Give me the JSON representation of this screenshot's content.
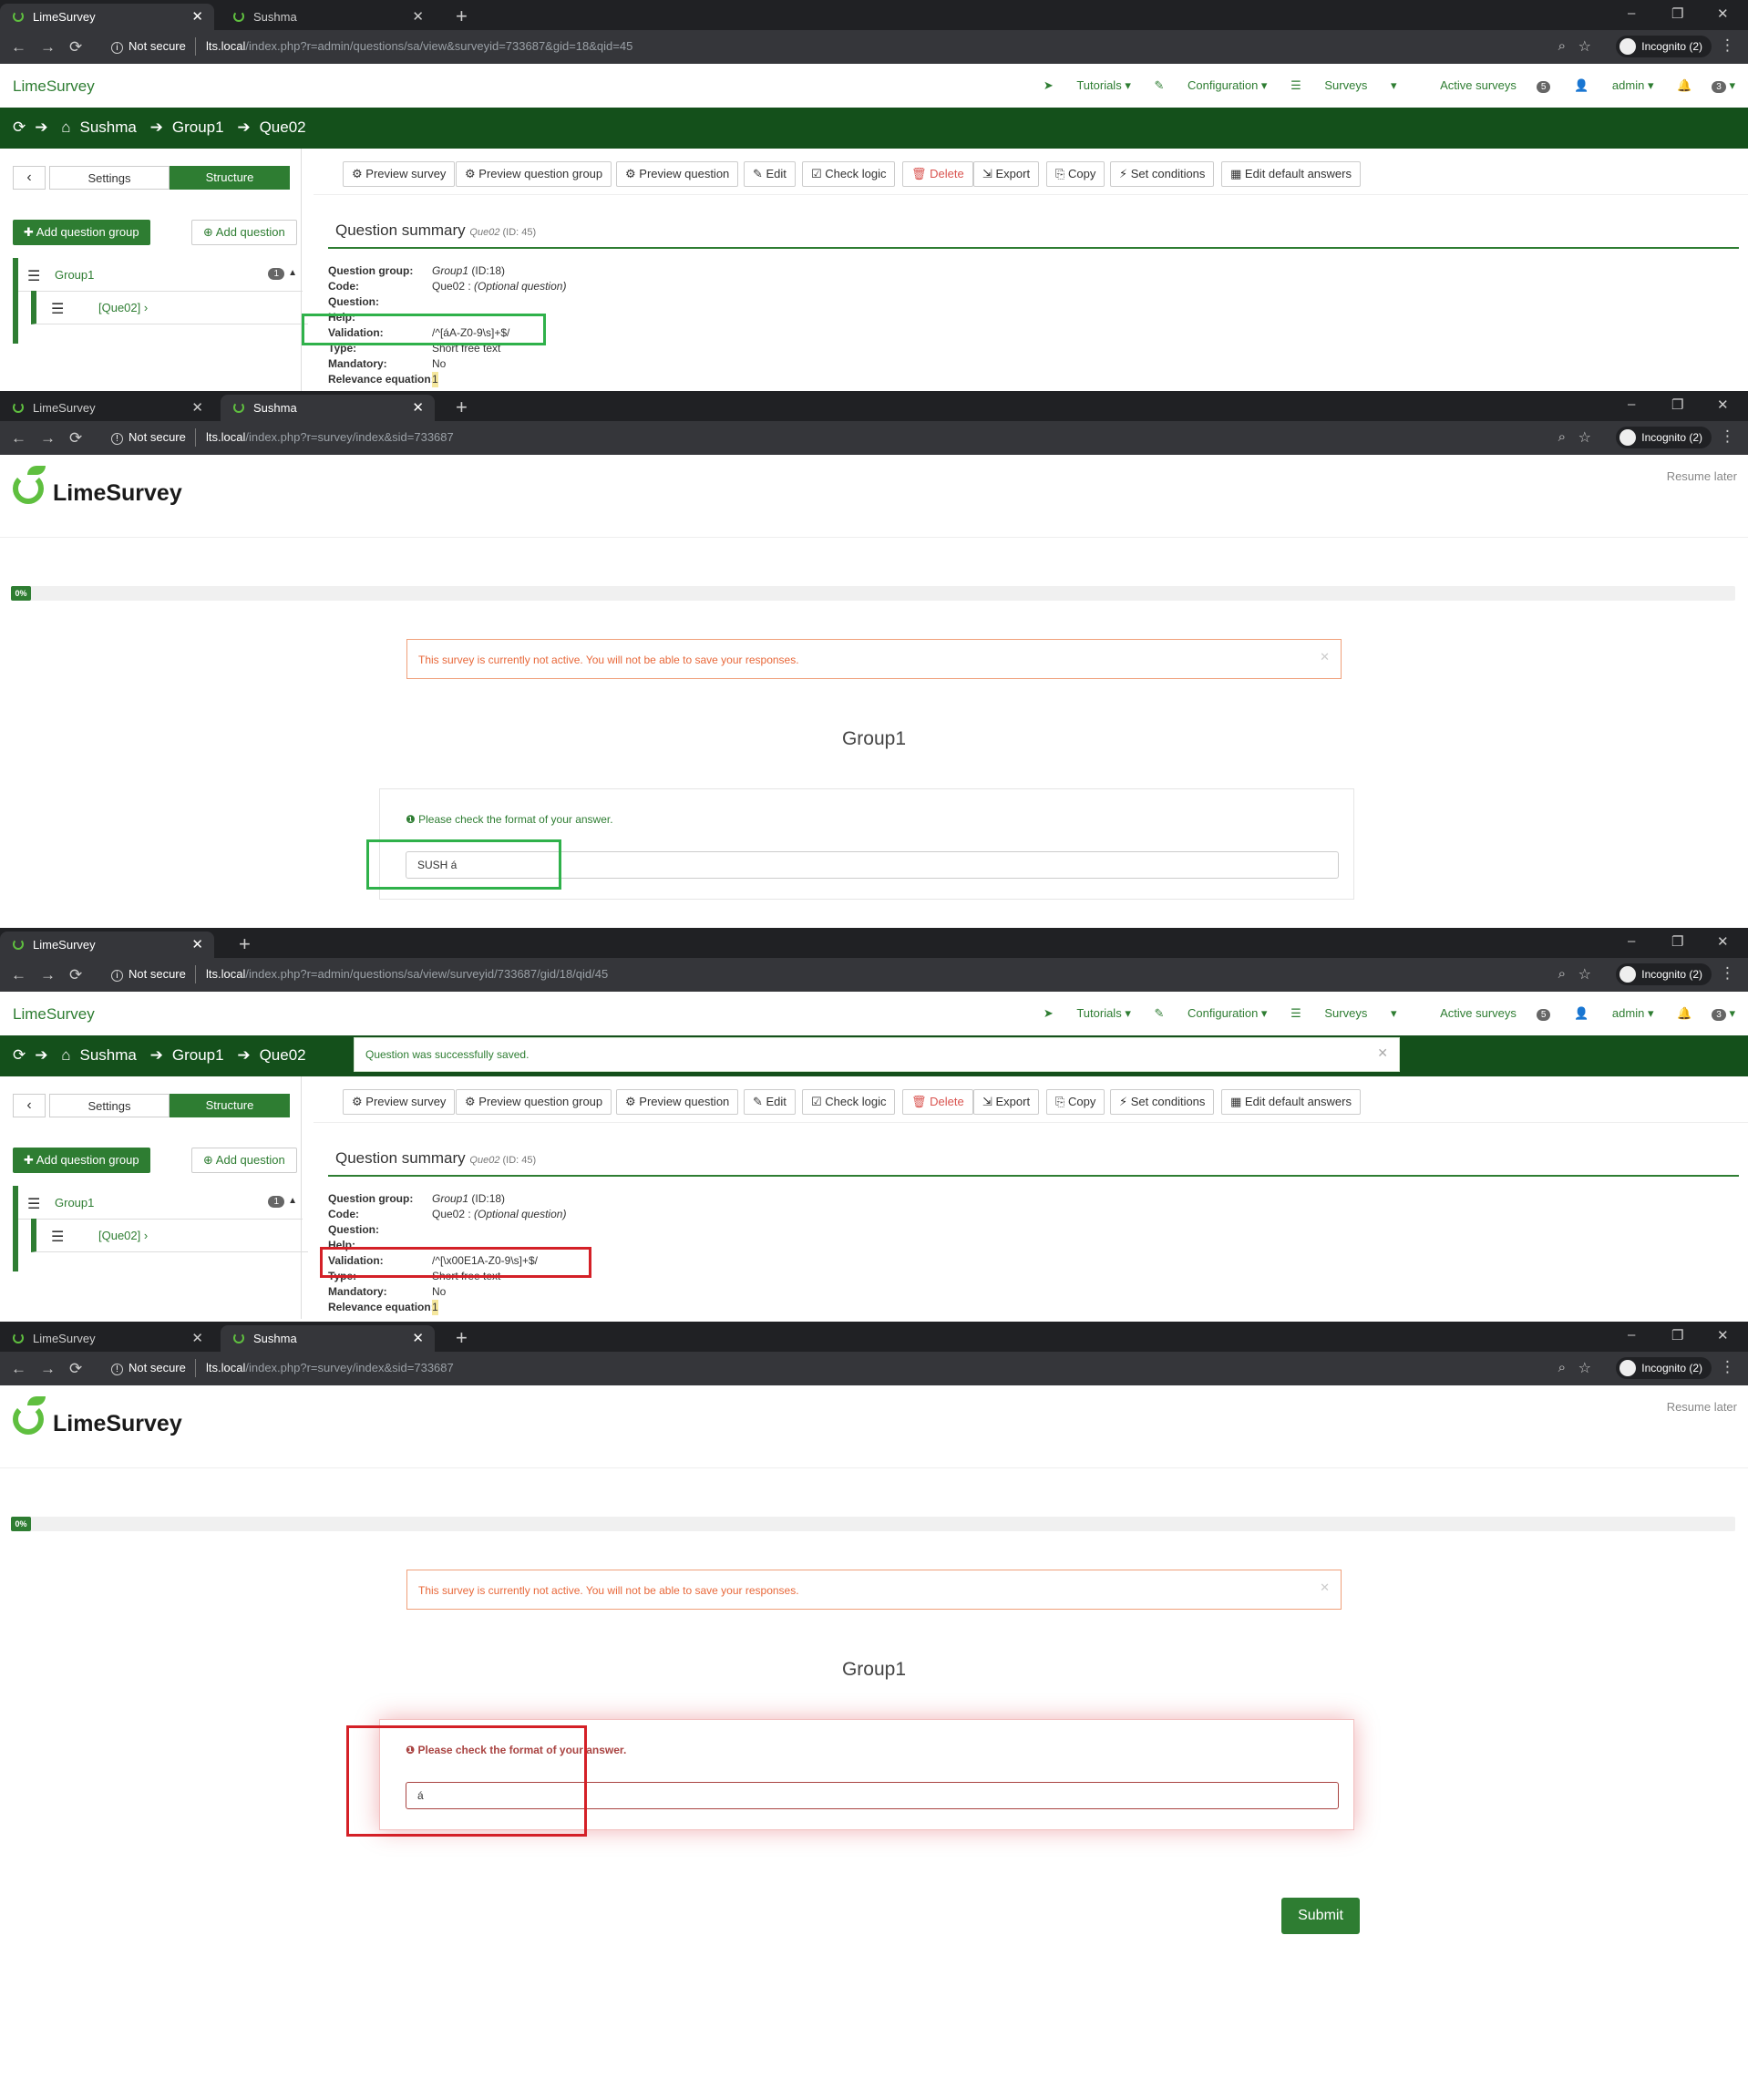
{
  "shared": {
    "tab1": "LimeSurvey",
    "tab2": "Sushma",
    "tab_close": "✕",
    "new_tab": "+",
    "not_secure": "Not secure",
    "incognito": "Incognito (2)",
    "host": "lts.local",
    "win_min": "–",
    "win_max": "❐",
    "win_close": "✕"
  },
  "panel1": {
    "url_path": "/index.php?r=admin/questions/sa/view&surveyid=733687&gid=18&qid=45"
  },
  "panel2": {
    "url_path": "/index.php?r=survey/index&sid=733687"
  },
  "panel3": {
    "url_path": "/index.php?r=admin/questions/sa/view/surveyid/733687/gid/18/qid/45"
  },
  "panel4": {
    "url_path": "/index.php?r=survey/index&sid=733687"
  },
  "admin": {
    "brand": "LimeSurvey",
    "menu": [
      "Tutorials",
      "Configuration",
      "Surveys",
      "Active surveys",
      "admin"
    ],
    "active_surveys_count": "5",
    "notif_count": "3",
    "breadcrumb": [
      "Sushma",
      "Group1",
      "Que02"
    ],
    "sidebar": {
      "settings": "Settings",
      "structure": "Structure",
      "add_group": "Add question group",
      "add_question": "Add question",
      "group_label": "Group1",
      "group_count": "1",
      "question_label": "[Que02]"
    },
    "toolbar": [
      "Preview survey",
      "Preview question group",
      "Preview question",
      "Edit",
      "Check logic",
      "Delete",
      "Export",
      "Copy",
      "Set conditions",
      "Edit default answers"
    ],
    "summary_title": "Question summary",
    "summary_code": "Que02",
    "summary_id": "(ID: 45)",
    "rows": {
      "group_k": "Question group:",
      "group_v": "Group1",
      "group_id": "(ID:18)",
      "code_k": "Code:",
      "code_v": "Que02 :",
      "code_opt": "(Optional question)",
      "question_k": "Question:",
      "help_k": "Help:",
      "validation_k": "Validation:",
      "type_k": "Type:",
      "type_v": "Short free text",
      "mandatory_k": "Mandatory:",
      "mandatory_v": "No",
      "relevance_k": "Relevance equation:",
      "relevance_v": "1"
    },
    "validation_before": "/^[áA-Z0-9\\s]+$/",
    "validation_after": "/^[\\x00E1A-Z0-9\\s]+$/",
    "saved_message": "Question was successfully saved."
  },
  "survey": {
    "brand": "LimeSurvey",
    "resume_later": "Resume later",
    "progress_label": "0%",
    "progress_fraction": 0,
    "warning": "This survey is currently not active. You will not be able to save your responses.",
    "group_title": "Group1",
    "tip": "Please check the format of your answer.",
    "answer_before": "SUSH á",
    "answer_after": "á",
    "submit": "Submit"
  },
  "colors": {
    "brand_green": "#2e7d32",
    "dark_green": "#14501b",
    "highlight_green": "#2fb14a",
    "highlight_red": "#d42027"
  }
}
